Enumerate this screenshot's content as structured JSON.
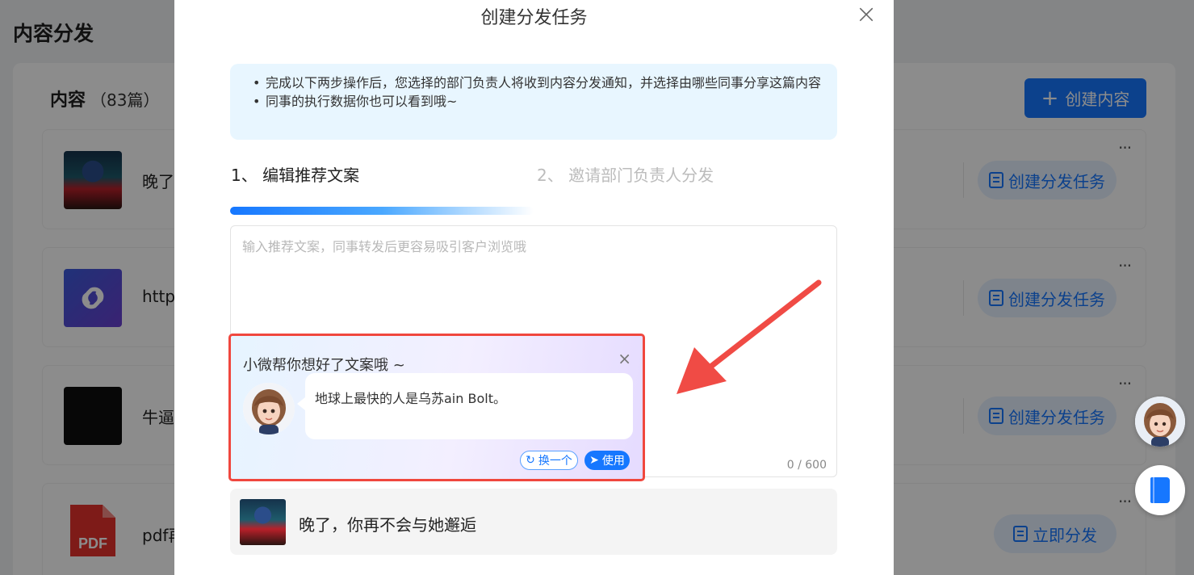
{
  "background": {
    "page_title": "内容分发",
    "content_heading": "内容",
    "content_count": "（83篇）",
    "create_content_label": "创建内容",
    "rows": [
      {
        "title": "晚了",
        "action": "创建分发任务",
        "thumb": "artwork"
      },
      {
        "title": "https",
        "action": "创建分发任务",
        "thumb": "link-icon"
      },
      {
        "title": "牛逼",
        "action": "创建分发任务",
        "thumb": "dark-screenshot"
      },
      {
        "title": "pdf再",
        "action": "立即分发",
        "thumb": "pdf-icon"
      }
    ],
    "pdf_label": "PDF",
    "more_label": "···"
  },
  "modal": {
    "title": "创建分发任务",
    "close_label": "×",
    "tips": [
      "完成以下两步操作后，您选择的部门负责人将收到内容分发通知，并选择由哪些同事分享这篇内容",
      "同事的执行数据你也可以看到哦~"
    ],
    "steps": [
      {
        "label": "1、 编辑推荐文案",
        "state": "active"
      },
      {
        "label": "2、 邀请部门负责人分发",
        "state": "inactive"
      }
    ],
    "progress_fraction": 0.5,
    "textarea": {
      "placeholder": "输入推荐文案，同事转发后更容易吸引客户浏览哦",
      "value": "",
      "char_count": "0 / 600"
    },
    "ai_suggestion": {
      "title": "小微帮你想好了文案哦 ~",
      "close_label": "×",
      "text": "地球上最快的人是乌苏ain Bolt。",
      "refresh_label": "换一个",
      "use_label": "使用"
    },
    "article": {
      "title": "晚了，你再不会与她邂逅"
    }
  },
  "colors": {
    "primary": "#1677ff",
    "highlight_border": "#f0473e",
    "tip_bg": "#e8f6ff",
    "annotation_arrow": "#f04b45"
  }
}
